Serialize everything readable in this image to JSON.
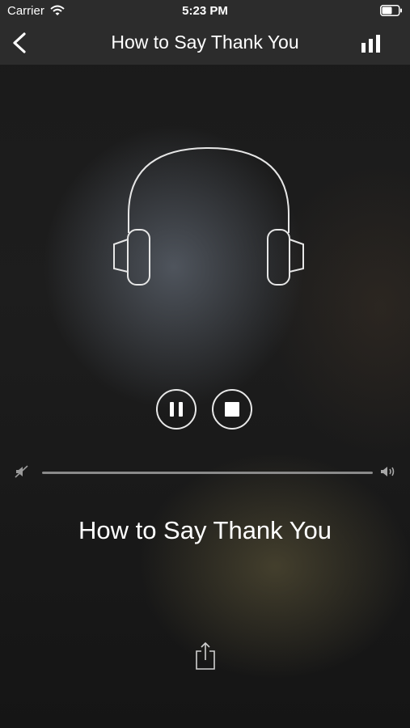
{
  "status_bar": {
    "carrier": "Carrier",
    "time": "5:23 PM"
  },
  "nav": {
    "title": "How to Say Thank You",
    "back_icon": "chevron-left-icon",
    "right_icon": "bar-chart-icon"
  },
  "player": {
    "artwork_icon": "headphones-icon",
    "controls": [
      "pause",
      "stop"
    ],
    "volume": {
      "min_icon": "volume-mute-icon",
      "max_icon": "volume-max-icon"
    },
    "track_title": "How to Say Thank You",
    "share_icon": "share-icon"
  },
  "colors": {
    "bar_background": "#2c2c2c",
    "foreground": "#ffffff",
    "track": "#8a8a8a"
  }
}
